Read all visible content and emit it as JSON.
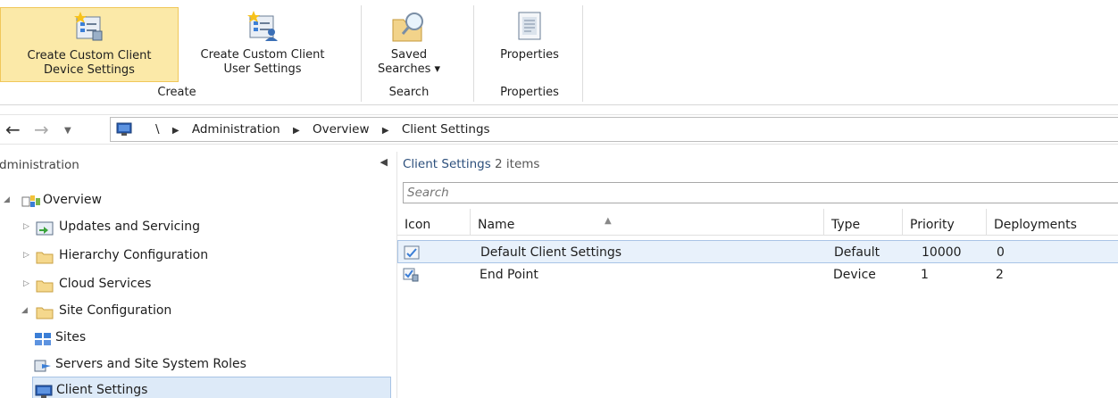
{
  "ribbon": {
    "buttons": [
      {
        "label_line1": "Create Custom Client",
        "label_line2": "Device Settings",
        "icon": "device-settings-icon",
        "active": true
      },
      {
        "label_line1": "Create Custom Client",
        "label_line2": "User Settings",
        "icon": "user-settings-icon",
        "active": false
      },
      {
        "label_line1": "Saved",
        "label_line2": "Searches ▾",
        "icon": "saved-searches-icon",
        "active": false
      },
      {
        "label_line1": "Properties",
        "label_line2": "",
        "icon": "properties-icon",
        "active": false
      }
    ],
    "groups": [
      "Create",
      "Search",
      "Properties"
    ]
  },
  "nav": {
    "crumbs": [
      "\\",
      "Administration",
      "Overview",
      "Client Settings"
    ]
  },
  "left": {
    "header": "Administration",
    "tree": [
      {
        "label": "Overview",
        "icon": "overview-icon"
      },
      {
        "label": "Updates and Servicing",
        "icon": "updates-icon"
      },
      {
        "label": "Hierarchy Configuration",
        "icon": "folder-icon"
      },
      {
        "label": "Cloud Services",
        "icon": "folder-icon"
      },
      {
        "label": "Site Configuration",
        "icon": "folder-icon"
      },
      {
        "label": "Sites",
        "icon": "sites-icon"
      },
      {
        "label": "Servers and Site System Roles",
        "icon": "servers-icon"
      },
      {
        "label": "Client Settings",
        "icon": "client-settings-icon"
      }
    ]
  },
  "right": {
    "title": "Client Settings",
    "count": "2 items",
    "search_placeholder": "Search",
    "columns": [
      "Icon",
      "Name",
      "Type",
      "Priority",
      "Deployments"
    ],
    "rows": [
      {
        "name": "Default Client Settings",
        "type": "Default",
        "priority": "10000",
        "deployments": "0"
      },
      {
        "name": "End Point",
        "type": "Device",
        "priority": "1",
        "deployments": "2"
      }
    ]
  },
  "colors": {
    "accent_selected": "#fbe9a8",
    "selection_blue": "#ddeaf8",
    "title_blue": "#2c4f7c"
  }
}
